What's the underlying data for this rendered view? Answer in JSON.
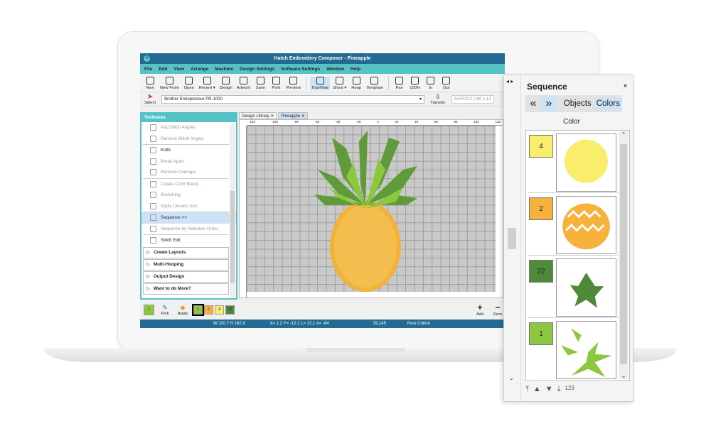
{
  "app": {
    "title": "Hatch Embroidery Composer - Pineapple",
    "logo": "H"
  },
  "menu": [
    "File",
    "Edit",
    "View",
    "Arrange",
    "Machine",
    "Design Settings",
    "Software Settings",
    "Window",
    "Help"
  ],
  "toolbar": [
    "New",
    "New From",
    "Open",
    "Recent ▾",
    "Design",
    "Artwork",
    "Save",
    "Print",
    "Preview",
    "TrueView",
    "Show ▾",
    "Hoop",
    "Template",
    "Pan",
    "100%",
    "In",
    "Out"
  ],
  "toolbar_active": "TrueView",
  "select_label": "Select",
  "machine": "Brother Entrepreneur PR-1000",
  "transfer_label": "Transfer",
  "hoop": "SAFF022 (180 x 13",
  "toolboxes": {
    "title": "Toolboxes",
    "tools": [
      {
        "label": "Add Stitch Angles",
        "enabled": false
      },
      {
        "label": "Remove Stitch Angles",
        "enabled": false
      },
      {
        "label": "Knife",
        "enabled": true
      },
      {
        "label": "Break Apart",
        "enabled": false
      },
      {
        "label": "Remove Overlaps",
        "enabled": false
      },
      {
        "label": "Create Color Blend...",
        "enabled": false
      },
      {
        "label": "Branching",
        "enabled": false
      },
      {
        "label": "Apply Closest Join",
        "enabled": false
      },
      {
        "label": "Sequence >>",
        "enabled": true,
        "selected": true
      },
      {
        "label": "Sequence by Selection Order",
        "enabled": false
      },
      {
        "label": "Stitch Edit",
        "enabled": true
      }
    ],
    "groups": [
      "Create Layouts",
      "Multi-Hooping",
      "Output Design",
      "Want to do More?"
    ]
  },
  "doc_tabs": [
    "Design Library",
    "Pineapple"
  ],
  "active_doc": "Pineapple",
  "ruler_labels": [
    "-120",
    "-100",
    "-80",
    "-60",
    "-40",
    "-20",
    "0",
    "20",
    "40",
    "60",
    "80",
    "100",
    "120"
  ],
  "palette": {
    "current": "1",
    "pick_label": "Pick",
    "apply_label": "Apply",
    "colors": [
      {
        "n": "1",
        "hex": "#8dc63f"
      },
      {
        "n": "2",
        "hex": "#f7b23b"
      },
      {
        "n": "4",
        "hex": "#f8ee6b"
      },
      {
        "n": "22",
        "hex": "#4f8a3a"
      }
    ],
    "add_label": "Add",
    "remove_label": "Rem"
  },
  "status": {
    "size": "W 110.7 H 162.9",
    "coords": "X=  1.2 Y= -12.1 L=  12.1 A= -84",
    "stitches": "29,145",
    "fabric": "Pure Cotton"
  },
  "sequence": {
    "title": "Sequence",
    "tabs": [
      "Objects",
      "Colors"
    ],
    "active_tab": "Colors",
    "column": "Color",
    "items": [
      {
        "n": "4",
        "hex": "#f8ee6b"
      },
      {
        "n": "2",
        "hex": "#f7b23b"
      },
      {
        "n": "22",
        "hex": "#4f8a3a"
      },
      {
        "n": "1",
        "hex": "#8dc63f"
      }
    ],
    "sort_label": "123"
  }
}
